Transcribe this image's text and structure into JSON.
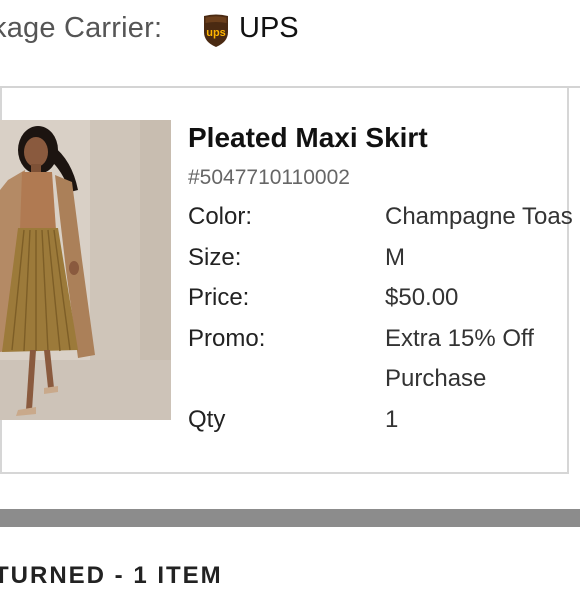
{
  "carrier": {
    "label": "kage Carrier:",
    "logo_text": "ups",
    "name": "UPS",
    "logo_colors": {
      "shield": "#4a2a12",
      "text": "#ffb500"
    }
  },
  "product": {
    "image_icon": "product-photo-woman-in-pleated-skirt",
    "title": "Pleated Maxi Skirt",
    "sku": "#5047710110002",
    "details": {
      "color_label": "Color:",
      "color_value": "Champagne Toas",
      "size_label": "Size:",
      "size_value": "M",
      "price_label": "Price:",
      "price_value": "$50.00",
      "promo_label": "Promo:",
      "promo_value_line1": "Extra 15% Off",
      "promo_value_line2": "Purchase",
      "qty_label": "Qty",
      "qty_value": "1"
    }
  },
  "returned": {
    "heading": "TURNED - 1 ITEM"
  }
}
